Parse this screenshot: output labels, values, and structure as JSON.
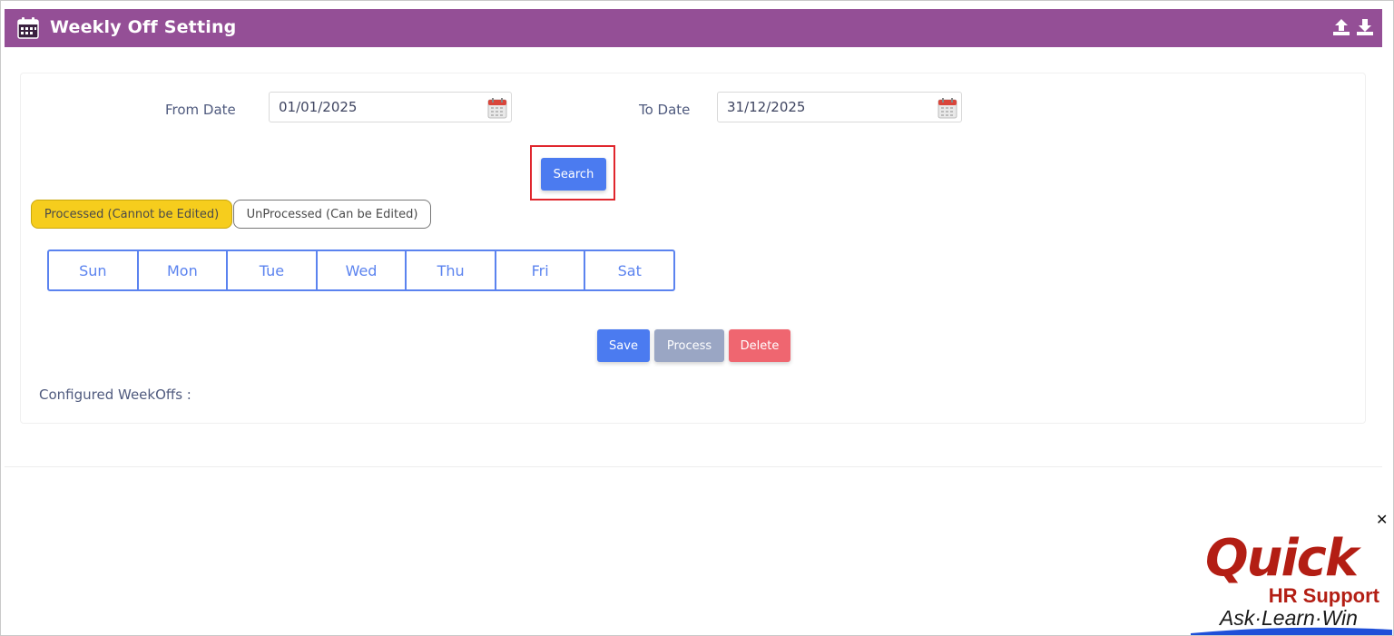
{
  "header": {
    "title": "Weekly Off Setting",
    "icons": [
      "calendar-icon",
      "upload-icon",
      "download-icon"
    ]
  },
  "filters": {
    "from_label": "From Date",
    "from_value": "01/01/2025",
    "to_label": "To Date",
    "to_value": "31/12/2025"
  },
  "actions": {
    "search_label": "Search",
    "save_label": "Save",
    "process_label": "Process",
    "delete_label": "Delete"
  },
  "status_tabs": {
    "processed_label": "Processed (Cannot be Edited)",
    "unprocessed_label": "UnProcessed (Can be Edited)",
    "processed_color": "#f6cd1d"
  },
  "days": [
    "Sun",
    "Mon",
    "Tue",
    "Wed",
    "Thu",
    "Fri",
    "Sat"
  ],
  "configured_label": "Configured WeekOffs :",
  "branding": {
    "word": "Quick",
    "subtitle": "HR Support",
    "tagline": "Ask·Learn·Win",
    "brand_color": "#b31e14"
  },
  "colors": {
    "header_bg": "#944f96",
    "primary": "#4b7bf0",
    "danger": "#ef6670",
    "muted": "#9aa6c4",
    "highlight_box": "#e0262d"
  }
}
